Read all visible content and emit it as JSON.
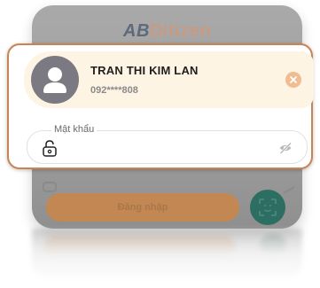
{
  "app": {
    "logo_prefix": "AB",
    "logo_suffix": "Ditizen"
  },
  "user": {
    "name": "TRAN THI KIM LAN",
    "phone": "092****808"
  },
  "password": {
    "label": "Mật khẩu",
    "value": ""
  },
  "login": {
    "button_label": "Đăng nhập"
  },
  "colors": {
    "accent": "#c98454",
    "user_card_bg": "#fdf4e3",
    "face_id": "#2c6e61"
  },
  "icons": {
    "avatar": "person-icon",
    "remove": "close-icon",
    "lock": "lock-icon",
    "visibility": "eye-off-icon",
    "face_id": "face-scan-icon"
  }
}
